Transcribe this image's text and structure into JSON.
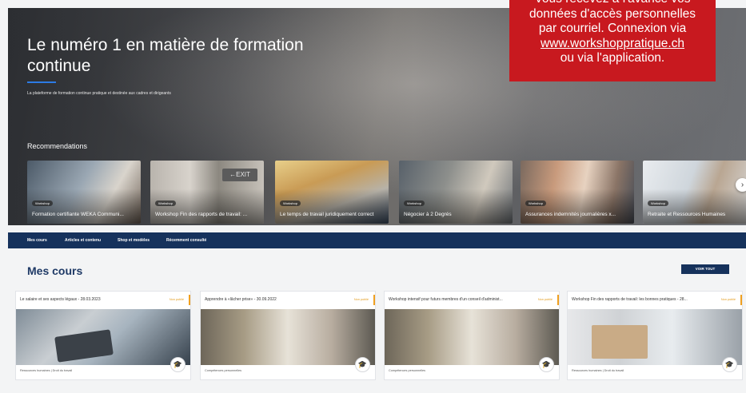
{
  "promo": {
    "line1": "Vous recevez à l'avance vos",
    "line2": "données d'accès personnelles",
    "line3": "par courriel. Connexion via",
    "link": "www.workshoppratique.ch",
    "line4": "ou via l'application.",
    "color": "#c8191f"
  },
  "hero": {
    "title": "Le numéro 1 en matière de formation continue",
    "subtitle": "La plateforme de formation continue pratique et destinée aux cadres et dirigeants",
    "recommendations_title": "Recommendations"
  },
  "recommendations": [
    {
      "badge": "Workshop",
      "label": "Formation certifiante WEKA Communi..."
    },
    {
      "badge": "Workshop",
      "label": "Workshop Fin des rapports de travail: ..."
    },
    {
      "badge": "Workshop",
      "label": "Le temps de travail juridiquement correct"
    },
    {
      "badge": "Workshop",
      "label": "Négocier à 2 Degrés"
    },
    {
      "badge": "Workshop",
      "label": "Assurances indemnités journalières x..."
    },
    {
      "badge": "Workshop",
      "label": "Retraite et Ressources Humaines"
    }
  ],
  "next_icon": "chevron-right-icon",
  "nav": {
    "items": [
      "Mes cours",
      "Articles et contenu",
      "Shop et modèles",
      "Récemment consulté"
    ],
    "color": "#16325c"
  },
  "mes_cours": {
    "title": "Mes cours",
    "voir_tout": "VOIR TOUT",
    "courses": [
      {
        "title": "Le salaire et ses aspects légaux - 28.03.2023",
        "status": "Non publié",
        "footer": "Ressources humaines  |  Droit du travail",
        "icon": "hat-icon"
      },
      {
        "title": "Apprendre à «lâcher prise» - 30.09.2022",
        "status": "Non publié",
        "footer": "Compétences personnelles",
        "icon": "hat-icon"
      },
      {
        "title": "Workshop intensif pour futurs membres d'un conseil d'administ...",
        "status": "Non publié",
        "footer": "Compétences personnelles",
        "icon": "hat-icon"
      },
      {
        "title": "Workshop Fin des rapports de travail: les bonnes pratiques - 28...",
        "status": "Non publié",
        "footer": "Ressources humaines  |  Droit du travail",
        "icon": "hat-icon"
      }
    ]
  }
}
